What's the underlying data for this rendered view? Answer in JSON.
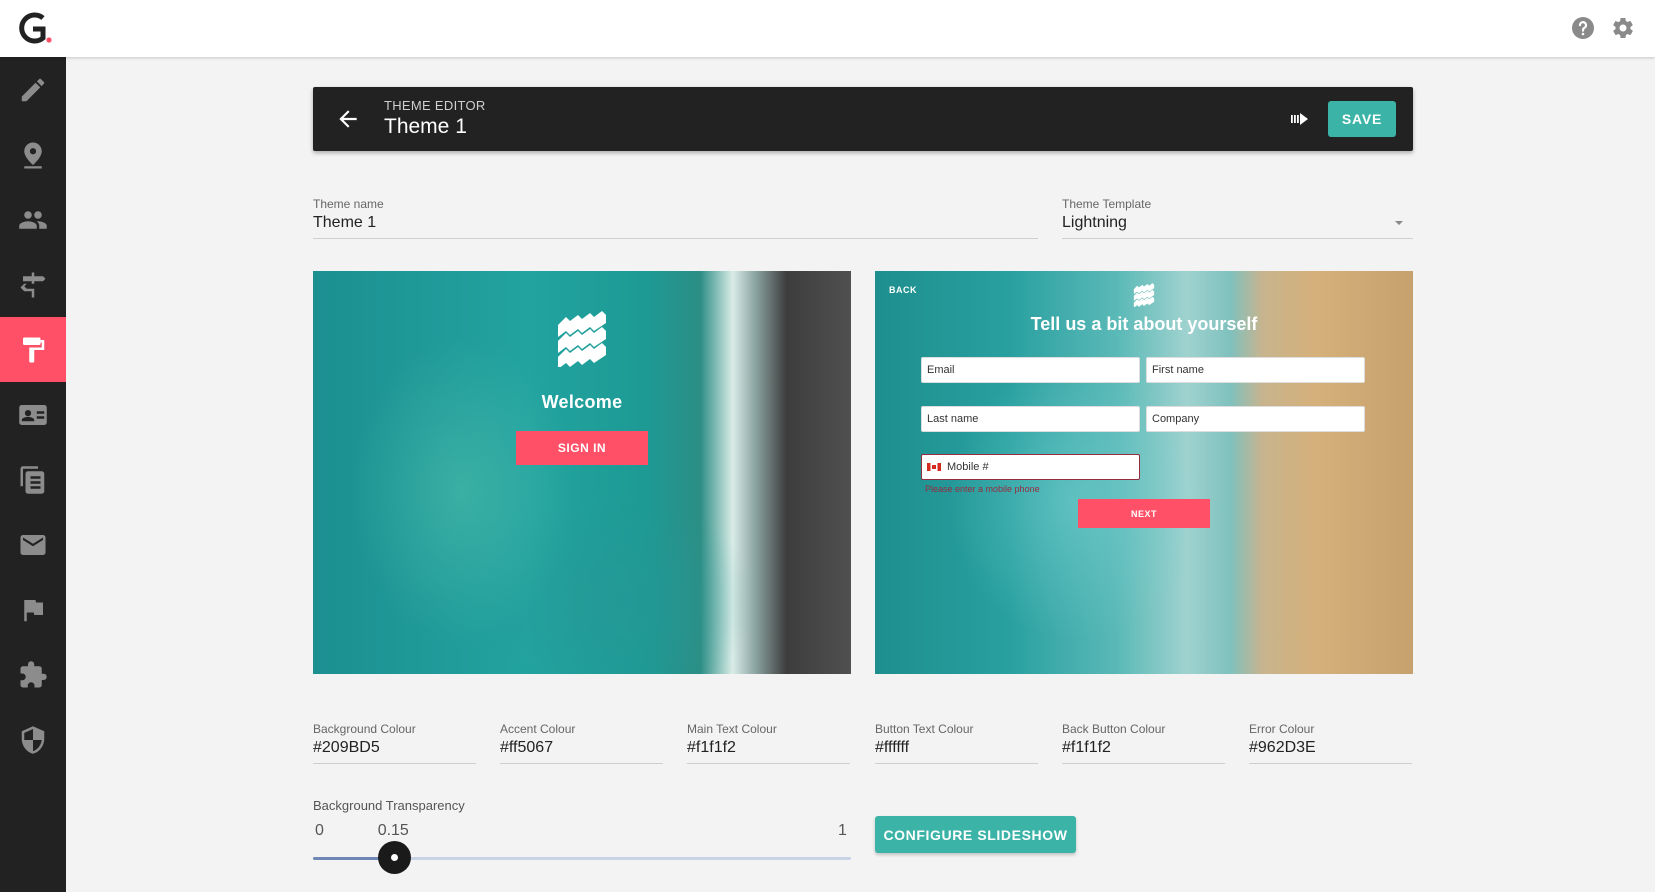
{
  "icons": {
    "logo": "app-logo",
    "help": "help-icon",
    "settings": "gear-icon"
  },
  "sidebar": {
    "items": [
      {
        "name": "pencil-icon"
      },
      {
        "name": "location-pin-icon"
      },
      {
        "name": "people-icon"
      },
      {
        "name": "signpost-icon"
      },
      {
        "name": "paint-roller-icon",
        "active": true
      },
      {
        "name": "id-card-icon"
      },
      {
        "name": "documents-icon"
      },
      {
        "name": "mail-icon"
      },
      {
        "name": "flag-icon"
      },
      {
        "name": "puzzle-icon"
      },
      {
        "name": "shield-icon"
      }
    ]
  },
  "header": {
    "subtitle": "THEME EDITOR",
    "title": "Theme 1",
    "save_label": "SAVE"
  },
  "form": {
    "theme_name": {
      "label": "Theme name",
      "value": "Theme 1"
    },
    "theme_template": {
      "label": "Theme Template",
      "value": "Lightning"
    }
  },
  "preview_welcome": {
    "welcome_text": "Welcome",
    "signin_label": "SIGN IN"
  },
  "preview_form": {
    "back_label": "BACK",
    "title": "Tell us a bit about yourself",
    "email_placeholder": "Email",
    "first_name_placeholder": "First name",
    "last_name_placeholder": "Last name",
    "company_placeholder": "Company",
    "mobile_placeholder": "Mobile #",
    "mobile_error": "Please enter a mobile phone",
    "next_label": "NEXT"
  },
  "colours": [
    {
      "label": "Background Colour",
      "value": "#209BD5"
    },
    {
      "label": "Accent Colour",
      "value": "#ff5067"
    },
    {
      "label": "Main Text Colour",
      "value": "#f1f1f2"
    },
    {
      "label": "Button Text Colour",
      "value": "#ffffff"
    },
    {
      "label": "Back Button Colour",
      "value": "#f1f1f2"
    },
    {
      "label": "Error Colour",
      "value": "#962D3E"
    }
  ],
  "transparency": {
    "label": "Background Transparency",
    "min": "0",
    "max": "1",
    "value": "0.15",
    "fraction": 0.15
  },
  "configure_label": "CONFIGURE SLIDESHOW",
  "brand_colors": {
    "accent": "#ff5067",
    "teal": "#3bb3a6",
    "dark": "#222222"
  }
}
